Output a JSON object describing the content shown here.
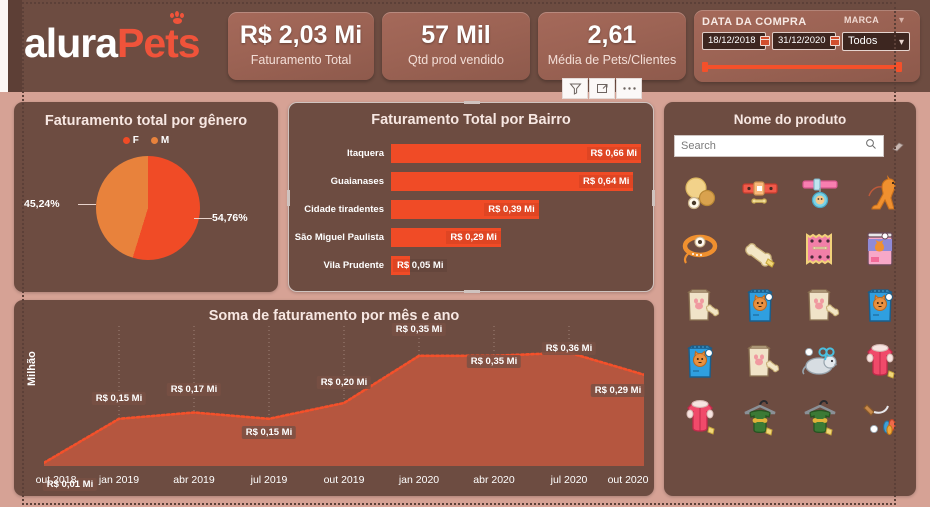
{
  "brand": {
    "name_light": "alura",
    "name_accent": "Pets",
    "paw_icon": "paw-icon"
  },
  "colors": {
    "page_bg": "#d6a295",
    "card_bg": "#6d4c41",
    "header_bg": "#6d4c41",
    "accent_primary": "#f04b26",
    "accent_secondary": "#e8823c",
    "kpi_bg": "#9c6354",
    "text_light": "#ffffff"
  },
  "kpis": [
    {
      "value": "R$ 2,03 Mi",
      "label": "Faturamento Total"
    },
    {
      "value": "57 Mil",
      "label": "Qtd prod vendido"
    },
    {
      "value": "2,61",
      "label": "Média de Pets/Clientes"
    }
  ],
  "filters": {
    "date_title": "DATA DA COMPRA",
    "date_start": "18/12/2018",
    "date_end": "31/12/2020",
    "calendar_icon": "calendar-icon",
    "brand_label": "MARCA",
    "brand_value": "Todos",
    "chevron_icon": "chevron-down-icon"
  },
  "viz_toolbar": {
    "filter_label": "filter-icon",
    "focus_label": "focus-mode-icon",
    "more_label": "more-options-icon"
  },
  "pie_card": {
    "title": "Faturamento total por gênero",
    "legend": [
      {
        "label": "F",
        "color": "#f04b26"
      },
      {
        "label": "M",
        "color": "#e8823c"
      }
    ],
    "labels": {
      "f": "54,76%",
      "m": "45,24%"
    }
  },
  "bar_card": {
    "title": "Faturamento Total por Bairro"
  },
  "line_card": {
    "title": "Soma de faturamento por mês e ano",
    "ylabel": "Milhão"
  },
  "product_card": {
    "title": "Nome do produto",
    "search_placeholder": "Search",
    "search_value": "",
    "search_icon": "search-icon",
    "eraser_icon": "eraser-icon",
    "items": [
      {
        "name": "product-ball-toys"
      },
      {
        "name": "product-collar-red-bone"
      },
      {
        "name": "product-collar-pink-tag"
      },
      {
        "name": "product-dog-on-leash"
      },
      {
        "name": "product-collar-orange"
      },
      {
        "name": "product-bone-treat"
      },
      {
        "name": "product-treat-bag-pink"
      },
      {
        "name": "product-cat-food-can"
      },
      {
        "name": "product-food-bag-cream-paw"
      },
      {
        "name": "product-food-bag-blue-cat"
      },
      {
        "name": "product-food-bag-cream-paw"
      },
      {
        "name": "product-food-bag-blue-cat"
      },
      {
        "name": "product-food-bag-blue-cat"
      },
      {
        "name": "product-food-bag-cream-paw"
      },
      {
        "name": "product-toy-mouse"
      },
      {
        "name": "product-pet-jacket-pink"
      },
      {
        "name": "product-pet-jacket-pink"
      },
      {
        "name": "product-pet-sweater-green-hanger"
      },
      {
        "name": "product-pet-sweater-green-hanger"
      },
      {
        "name": "product-feather-wand-toy"
      }
    ]
  },
  "chart_data": [
    {
      "type": "pie",
      "title": "Faturamento total por gênero",
      "categories": [
        "F",
        "M"
      ],
      "values": [
        54.76,
        45.24
      ],
      "value_labels": [
        "54,76%",
        "45,24%"
      ],
      "colors": [
        "#f04b26",
        "#e8823c"
      ],
      "legend_position": "top",
      "unit": "%"
    },
    {
      "type": "bar",
      "orientation": "horizontal",
      "title": "Faturamento Total por Bairro",
      "categories": [
        "Itaquera",
        "Guaianases",
        "Cidade tiradentes",
        "São Miguel Paulista",
        "Vila Prudente"
      ],
      "values": [
        0.66,
        0.64,
        0.39,
        0.29,
        0.05
      ],
      "value_labels": [
        "R$ 0,66 Mi",
        "R$ 0,64 Mi",
        "R$ 0,39 Mi",
        "R$ 0,29 Mi",
        "R$ 0,05 Mi"
      ],
      "xlabel": "",
      "ylabel": "",
      "xlim": [
        0,
        0.7
      ],
      "grid": false,
      "color": "#f04b26"
    },
    {
      "type": "area",
      "title": "Soma de faturamento por mês e ano",
      "xlabel": "",
      "ylabel": "Milhão",
      "x": [
        "out 2018",
        "jan 2019",
        "abr 2019",
        "jul 2019",
        "out 2019",
        "jan 2020",
        "abr 2020",
        "jul 2020",
        "out 2020"
      ],
      "values": [
        0.01,
        0.15,
        0.17,
        0.15,
        0.2,
        0.35,
        0.35,
        0.36,
        0.29
      ],
      "value_labels": [
        "R$ 0,01 Mi",
        "R$ 0,15 Mi",
        "R$ 0,17 Mi",
        "R$ 0,15 Mi",
        "R$ 0,20 Mi",
        "R$ 0,35 Mi",
        "R$ 0,35 Mi",
        "R$ 0,36 Mi",
        "R$ 0,29 Mi"
      ],
      "ylim": [
        0,
        0.4
      ],
      "grid": true,
      "line_color": "#f4502a",
      "line_style": "dotted",
      "fill_color": "#b5563f"
    }
  ]
}
